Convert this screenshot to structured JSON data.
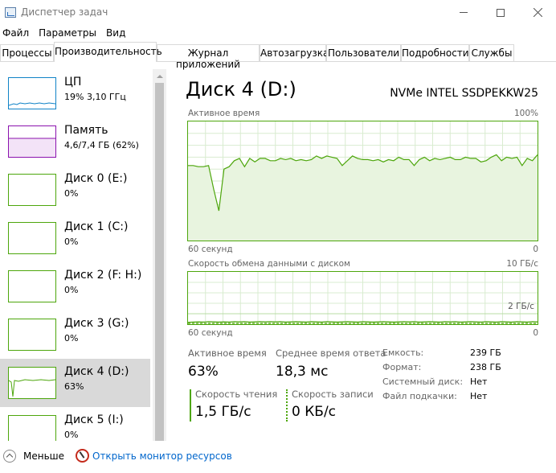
{
  "window": {
    "title": "Диспетчер задач",
    "controls": {
      "minimize": "minimize",
      "maximize": "maximize",
      "close": "close"
    }
  },
  "menu": [
    "Файл",
    "Параметры",
    "Вид"
  ],
  "tabs": [
    {
      "label": "Процессы",
      "active": false
    },
    {
      "label": "Производительность",
      "active": true
    },
    {
      "label": "Журнал приложений",
      "active": false
    },
    {
      "label": "Автозагрузка",
      "active": false
    },
    {
      "label": "Пользователи",
      "active": false
    },
    {
      "label": "Подробности",
      "active": false
    },
    {
      "label": "Службы",
      "active": false
    }
  ],
  "sidebar": {
    "items": [
      {
        "name": "ЦП",
        "value": "19% 3,10 ГГц",
        "color": "#1083c7",
        "selected": false
      },
      {
        "name": "Память",
        "value": "4,6/7,4 ГБ (62%)",
        "color": "#8b12ae",
        "selected": false
      },
      {
        "name": "Диск 0 (E:)",
        "value": "0%",
        "color": "#4da60c",
        "selected": false
      },
      {
        "name": "Диск 1 (C:)",
        "value": "0%",
        "color": "#4da60c",
        "selected": false
      },
      {
        "name": "Диск 2 (F: H:)",
        "value": "0%",
        "color": "#4da60c",
        "selected": false
      },
      {
        "name": "Диск 3 (G:)",
        "value": "0%",
        "color": "#4da60c",
        "selected": false
      },
      {
        "name": "Диск 4 (D:)",
        "value": "63%",
        "color": "#4da60c",
        "selected": true
      },
      {
        "name": "Диск 5 (I:)",
        "value": "0%",
        "color": "#4da60c",
        "selected": false
      }
    ]
  },
  "main": {
    "title": "Диск 4 (D:)",
    "device": "NVMe INTEL SSDPEKKW25",
    "graph1": {
      "label": "Активное время",
      "max": "100%",
      "time": "60 секунд",
      "min": "0",
      "values": [
        63,
        63,
        62,
        62,
        63,
        43,
        25,
        60,
        62,
        67,
        69,
        62,
        69,
        66,
        69,
        69,
        67,
        67,
        69,
        68,
        69,
        67,
        68,
        67,
        68,
        71,
        69,
        71,
        70,
        69,
        63,
        67,
        71,
        69,
        68,
        68,
        67,
        68,
        66,
        68,
        67,
        70,
        68,
        68,
        63,
        68,
        70,
        67,
        69,
        68,
        69,
        70,
        68,
        68,
        70,
        69,
        69,
        66,
        67,
        70,
        72,
        67,
        70,
        69,
        70,
        63,
        69,
        67,
        72
      ]
    },
    "graph2": {
      "label": "Скорость обмена данными с диском",
      "max": "10 ГБ/с",
      "mid": "2 ГБ/с",
      "time": "60 секунд",
      "min": "0",
      "read_values": [
        0.35,
        0.4,
        0.45,
        0.4,
        0.5,
        0.45,
        0.4,
        0.45,
        0.4,
        0.5,
        0.45,
        0.5,
        0.4,
        0.45,
        0.5,
        0.45,
        0.5,
        0.45,
        0.5,
        0.4,
        0.45,
        0.5,
        0.45,
        0.4,
        0.5,
        0.45,
        0.4,
        0.5,
        0.45,
        0.4,
        0.45,
        0.5,
        0.45,
        0.4,
        0.5,
        0.45,
        0.4,
        0.45,
        0.5,
        0.45,
        0.4,
        0.45,
        0.5,
        0.45,
        0.5,
        0.4,
        0.45,
        0.5,
        0.45,
        0.4,
        0.5,
        0.45,
        0.5,
        0.4,
        0.45,
        0.5,
        0.45,
        0.4,
        0.5,
        0.45,
        0.4,
        0.5,
        0.45,
        0.4,
        0.5,
        0.45,
        0.4,
        0.5,
        0.45
      ],
      "write_values": [
        0.15,
        0.15,
        0.15,
        0.15,
        0.15,
        0.15,
        0.15,
        0.15,
        0.15,
        0.15,
        0.15,
        0.15,
        0.15,
        0.15,
        0.15,
        0.15,
        0.15,
        0.15,
        0.15,
        0.15,
        0.15,
        0.15,
        0.15,
        0.15,
        0.15,
        0.15,
        0.15,
        0.15,
        0.15,
        0.15,
        0.15,
        0.15,
        0.15,
        0.15,
        0.15,
        0.15,
        0.15,
        0.15,
        0.15,
        0.15,
        0.15,
        0.15,
        0.15,
        0.15,
        0.15,
        0.15,
        0.15,
        0.15,
        0.15,
        0.15,
        0.15,
        0.15,
        0.15,
        0.15,
        0.15,
        0.15,
        0.15,
        0.15,
        0.15,
        0.15,
        0.15,
        0.15,
        0.15,
        0.15,
        0.15,
        0.15,
        0.15,
        0.15,
        0.15
      ]
    },
    "stats": {
      "active_time_label": "Активное время",
      "active_time_value": "63%",
      "response_label": "Среднее время ответа",
      "response_value": "18,3 мс",
      "read_label": "Скорость чтения",
      "read_value": "1,5 ГБ/с",
      "write_label": "Скорость записи",
      "write_value": "0 КБ/с"
    },
    "info": [
      {
        "label": "Емкость:",
        "value": "239 ГБ"
      },
      {
        "label": "Формат:",
        "value": "238 ГБ"
      },
      {
        "label": "Системный диск:",
        "value": "Нет"
      },
      {
        "label": "Файл подкачки:",
        "value": "Нет"
      }
    ]
  },
  "footer": {
    "fewer": "Меньше",
    "monitor": "Открыть монитор ресурсов"
  },
  "colors": {
    "disk": "#4da60c",
    "cpu": "#1083c7",
    "memory": "#8b12ae",
    "link": "#0066cc"
  }
}
